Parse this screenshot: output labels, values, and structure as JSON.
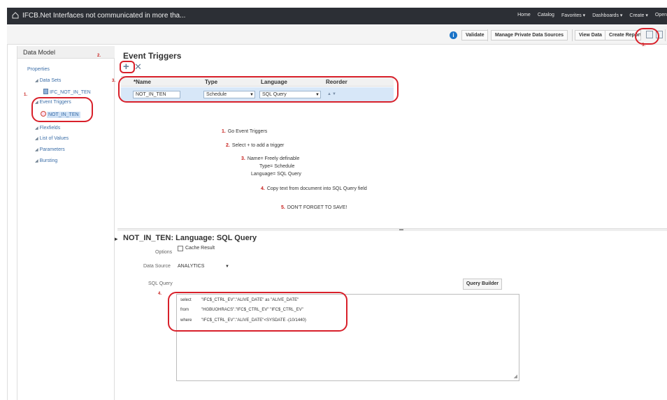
{
  "window": {
    "title": "IFCB.Net Interfaces not communicated in more tha..."
  },
  "top_nav": [
    "Home",
    "Catalog",
    "Favorites ▾",
    "Dashboards ▾",
    "Create ▾",
    "Open"
  ],
  "toolbar": {
    "validate": "Validate",
    "manage_private": "Manage Private Data Sources",
    "view_data": "View Data",
    "create_report": "Create Report"
  },
  "left_panel": {
    "header": "Data Model",
    "properties": "Properties",
    "data_sets": "Data Sets",
    "data_set_item": "IFC_NOT_IN_TEN",
    "event_triggers": "Event Triggers",
    "trigger_item": "NOT_IN_TEN",
    "flexfields": "Flexfields",
    "list_of_values": "List of Values",
    "parameters": "Parameters",
    "bursting": "Bursting"
  },
  "event_triggers": {
    "title": "Event Triggers",
    "columns": [
      "*Name",
      "Type",
      "Language",
      "Reorder"
    ],
    "row": {
      "name": "NOT_IN_TEN",
      "type": "Schedule",
      "language": "SQL Query"
    }
  },
  "annotations": {
    "n1": "1.",
    "n2": "2.",
    "n3": "3.",
    "n4": "4.",
    "n5": "5."
  },
  "instructions": {
    "step1_num": "1.",
    "step1": "Go Event Triggers",
    "step2_num": "2.",
    "step2": "Select + to add a trigger",
    "step3_num": "3.",
    "step3_a": "Name= Freely definable",
    "step3_b": "Type= Schedule",
    "step3_c": "Language= SQL Query",
    "step4_num": "4.",
    "step4": "Copy text from document into SQL Query field",
    "step5_num": "5.",
    "step5": "DON'T FORGET TO SAVE!"
  },
  "query": {
    "title": "NOT_IN_TEN: Language: SQL Query",
    "options_label": "Options",
    "cache_result": "Cache Result",
    "data_source_label": "Data Source",
    "data_source_value": "ANALYTICS",
    "sql_label": "SQL Query",
    "query_builder": "Query Builder",
    "sql": [
      {
        "kw": "select",
        "text": "\"IFC$_CTRL_EV\".\"ALIVE_DATE\" as \"ALIVE_DATE\""
      },
      {
        "kw": "from",
        "text": "\"HGBUOHRACS\".\"IFC$_CTRL_EV\" \"IFC$_CTRL_EV\""
      },
      {
        "kw": "where",
        "text": "\"IFC$_CTRL_EV\".\"ALIVE_DATE\"<SYSDATE -(10/1440)"
      }
    ]
  },
  "colors": {
    "annotation": "#d8202a",
    "accent": "#1a73c7",
    "topbar": "#2c2f35"
  }
}
